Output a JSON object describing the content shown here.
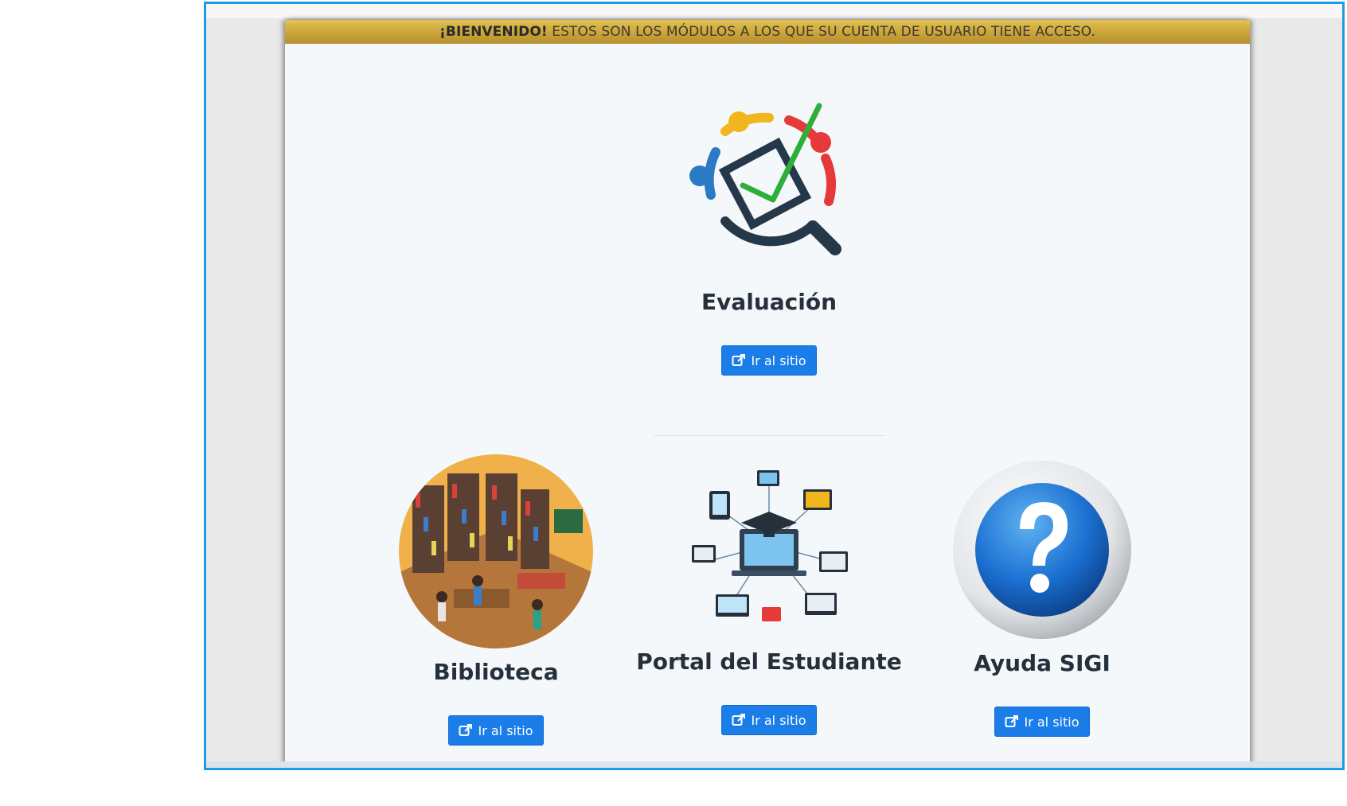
{
  "banner": {
    "welcome_bold": "¡BIENVENIDO!",
    "welcome_text": "ESTOS SON LOS MÓDULOS A LOS QUE SU CUENTA DE USUARIO TIENE ACCESO."
  },
  "modules": {
    "evaluacion": {
      "title": "Evaluación",
      "button": "Ir al sitio",
      "icon": "evaluation-checkmark-icon"
    },
    "biblioteca": {
      "title": "Biblioteca",
      "button": "Ir al sitio",
      "icon": "library-illustration-icon"
    },
    "portal": {
      "title": "Portal del Estudiante",
      "button": "Ir al sitio",
      "icon": "student-portal-icon"
    },
    "ayuda": {
      "title": "Ayuda SIGI",
      "button": "Ir al sitio",
      "icon": "help-question-icon"
    }
  },
  "colors": {
    "frame_border": "#1e9be6",
    "banner_gold": "#c9a43a",
    "button_blue": "#1a7de8",
    "panel_bg": "#f5f8fb"
  }
}
